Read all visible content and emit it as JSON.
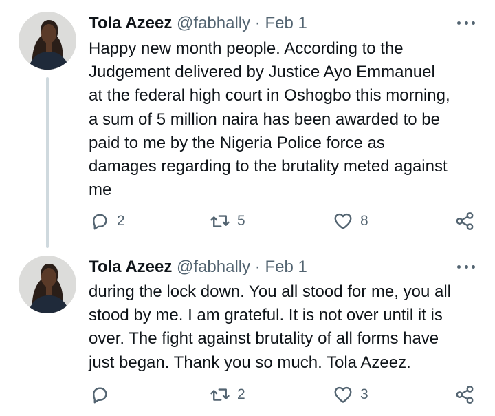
{
  "tweets": [
    {
      "name": "Tola Azeez",
      "handle": "@fabhally",
      "separator": "·",
      "date": "Feb 1",
      "text": "Happy new month people. According to the\nJudgement  delivered by Justice Ayo Emmanuel\nat the federal high court in Oshogbo this morning,\na sum of 5 million naira has been awarded to be\npaid to me by the Nigeria Police force as\ndamages regarding to the brutality meted against\nme",
      "replies": "2",
      "retweets": "5",
      "likes": "8"
    },
    {
      "name": "Tola Azeez",
      "handle": "@fabhally",
      "separator": "·",
      "date": "Feb 1",
      "text": "during the lock down. You all stood for me, you all\nstood by me. I am grateful. It is not over until it is\nover. The fight against brutality of all forms have\njust began.  Thank you so much. Tola Azeez.",
      "replies": "",
      "retweets": "2",
      "likes": "3"
    }
  ],
  "colors": {
    "text": "#0f1419",
    "secondary": "#536471",
    "thread_line": "#cfd9de"
  },
  "icons": {
    "avatar": "profile-photo",
    "more": "more-dots-icon",
    "reply": "reply-icon",
    "retweet": "retweet-icon",
    "like": "heart-icon",
    "share": "share-icon"
  }
}
